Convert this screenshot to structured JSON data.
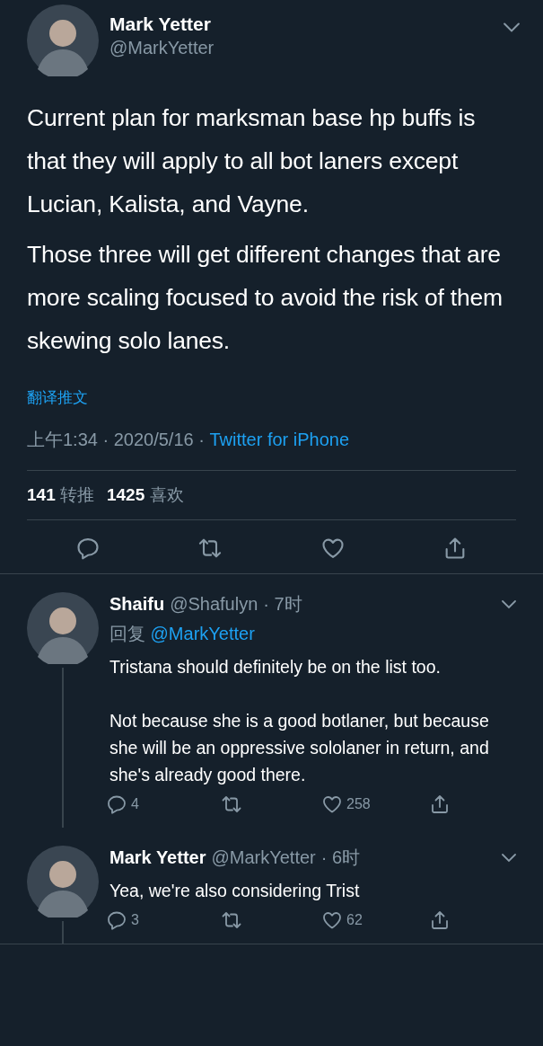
{
  "tweet": {
    "author": {
      "name": "Mark Yetter",
      "handle": "@MarkYetter"
    },
    "paragraphs": [
      "Current plan for marksman base hp buffs is that they will apply to all bot laners except Lucian, Kalista, and Vayne.",
      "Those three will get different changes that are more scaling focused to avoid the risk of them skewing solo lanes."
    ],
    "translate_link": "翻译推文",
    "timestamp": "上午1:34 · 2020/5/16 · ",
    "source": "Twitter for iPhone",
    "stats": [
      {
        "count": "141",
        "label": "转推"
      },
      {
        "count": "1425",
        "label": "喜欢"
      }
    ],
    "actions": [
      {
        "kind": "reply"
      },
      {
        "kind": "retweet"
      },
      {
        "kind": "like"
      },
      {
        "kind": "share"
      }
    ]
  },
  "replies": [
    {
      "name": "Shaifu",
      "handle": "@Shafulyn",
      "time": "· 7时",
      "reply_to": {
        "prefix": "回复",
        "handle": "@MarkYetter"
      },
      "paragraphs": [
        "Tristana should definitely be on the list too.",
        "Not because she is a good botlaner, but because she will be an oppressive sololaner in return, and she's already good there."
      ],
      "actions": [
        {
          "kind": "reply",
          "count": "4"
        },
        {
          "kind": "retweet"
        },
        {
          "kind": "like",
          "count": "258"
        },
        {
          "kind": "share"
        }
      ]
    },
    {
      "name": "Mark Yetter",
      "handle": "@MarkYetter",
      "time": "· 6时",
      "paragraphs": [
        "Yea, we're also considering Trist"
      ],
      "actions": [
        {
          "kind": "reply",
          "count": "3"
        },
        {
          "kind": "retweet"
        },
        {
          "kind": "like",
          "count": "62"
        },
        {
          "kind": "share"
        }
      ]
    }
  ]
}
